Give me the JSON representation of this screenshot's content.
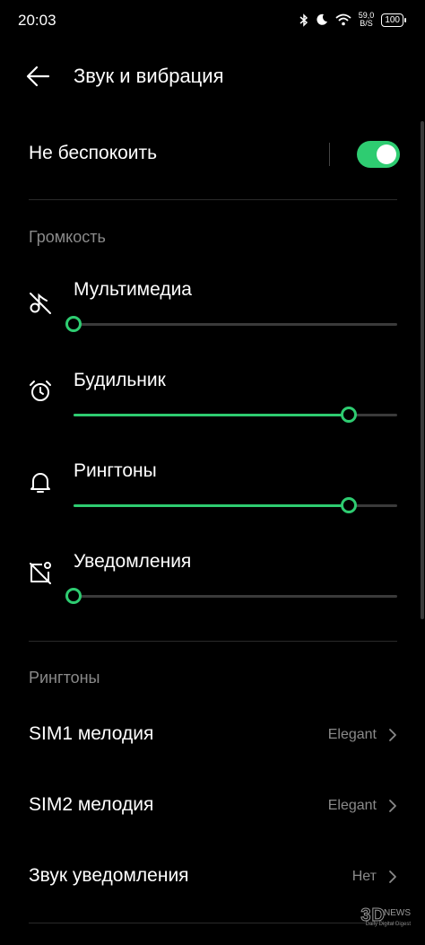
{
  "status_bar": {
    "time": "20:03",
    "net_speed_value": "59,0",
    "net_speed_unit": "B/S",
    "battery": "100",
    "icons": [
      "bluetooth-icon",
      "moon-icon",
      "wifi-icon"
    ]
  },
  "header": {
    "title": "Звук и вибрация"
  },
  "dnd": {
    "label": "Не беспокоить",
    "enabled": true
  },
  "volume": {
    "section_title": "Громкость",
    "items": [
      {
        "label": "Мультимедиа",
        "icon": "music-muted-icon",
        "level": 0.0
      },
      {
        "label": "Будильник",
        "icon": "alarm-clock-icon",
        "level": 0.85
      },
      {
        "label": "Рингтоны",
        "icon": "bell-icon",
        "level": 0.85
      },
      {
        "label": "Уведомления",
        "icon": "notification-muted-icon",
        "level": 0.0
      }
    ]
  },
  "ringtones": {
    "section_title": "Рингтоны",
    "items": [
      {
        "label": "SIM1 мелодия",
        "value": "Elegant"
      },
      {
        "label": "SIM2 мелодия",
        "value": "Elegant"
      },
      {
        "label": "Звук уведомления",
        "value": "Нет"
      }
    ]
  },
  "watermark": {
    "brand_main": "3D",
    "brand_news": "NEWS",
    "tagline": "Daily Digital Digest"
  },
  "colors": {
    "accent": "#2ecc71",
    "background": "#000000",
    "muted_text": "#8a8a8a"
  }
}
